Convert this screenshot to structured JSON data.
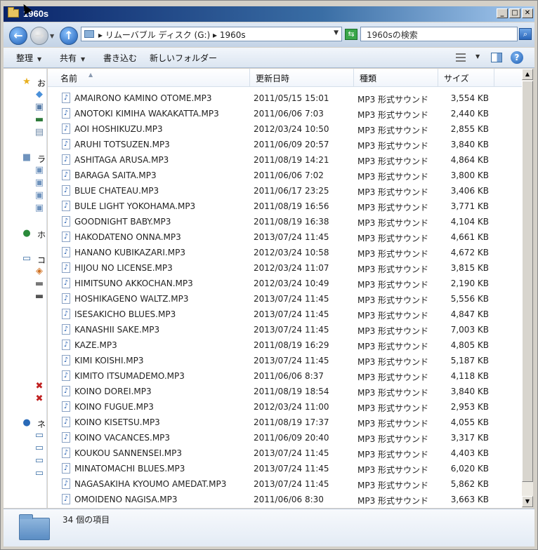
{
  "window": {
    "title": "1960s"
  },
  "address": {
    "path": "▸ リムーバブル ディスク (G:) ▸ 1960s",
    "search_placeholder": "1960sの検索"
  },
  "toolbar": {
    "organize": "整理",
    "share": "共有",
    "burn": "書き込む",
    "new_folder": "新しいフォルダー"
  },
  "navpane": {
    "favorites": "お",
    "libraries": "ラ",
    "homegroup": "ホ",
    "computer": "コ",
    "network": "ネ"
  },
  "columns": {
    "name": "名前",
    "date": "更新日時",
    "type": "種類",
    "size": "サイズ"
  },
  "files": [
    {
      "name": "AMAIRONO KAMINO OTOME.MP3",
      "date": "2011/05/15 15:01",
      "type": "MP3 形式サウンド",
      "size": "3,554 KB"
    },
    {
      "name": "ANOTOKI KIMIHA WAKAKATTA.MP3",
      "date": "2011/06/06 7:03",
      "type": "MP3 形式サウンド",
      "size": "2,440 KB"
    },
    {
      "name": "AOI HOSHIKUZU.MP3",
      "date": "2012/03/24 10:50",
      "type": "MP3 形式サウンド",
      "size": "2,855 KB"
    },
    {
      "name": "ARUHI TOTSUZEN.MP3",
      "date": "2011/06/09 20:57",
      "type": "MP3 形式サウンド",
      "size": "3,840 KB"
    },
    {
      "name": "ASHITAGA ARUSA.MP3",
      "date": "2011/08/19 14:21",
      "type": "MP3 形式サウンド",
      "size": "4,864 KB"
    },
    {
      "name": "BARAGA SAITA.MP3",
      "date": "2011/06/06 7:02",
      "type": "MP3 形式サウンド",
      "size": "3,800 KB"
    },
    {
      "name": "BLUE CHATEAU.MP3",
      "date": "2011/06/17 23:25",
      "type": "MP3 形式サウンド",
      "size": "3,406 KB"
    },
    {
      "name": "BULE LIGHT YOKOHAMA.MP3",
      "date": "2011/08/19 16:56",
      "type": "MP3 形式サウンド",
      "size": "3,771 KB"
    },
    {
      "name": "GOODNIGHT BABY.MP3",
      "date": "2011/08/19 16:38",
      "type": "MP3 形式サウンド",
      "size": "4,104 KB"
    },
    {
      "name": "HAKODATENO ONNA.MP3",
      "date": "2013/07/24 11:45",
      "type": "MP3 形式サウンド",
      "size": "4,661 KB"
    },
    {
      "name": "HANANO KUBIKAZARI.MP3",
      "date": "2012/03/24 10:58",
      "type": "MP3 形式サウンド",
      "size": "4,672 KB"
    },
    {
      "name": "HIJOU NO LICENSE.MP3",
      "date": "2012/03/24 11:07",
      "type": "MP3 形式サウンド",
      "size": "3,815 KB"
    },
    {
      "name": "HIMITSUNO AKKOCHAN.MP3",
      "date": "2012/03/24 10:49",
      "type": "MP3 形式サウンド",
      "size": "2,190 KB"
    },
    {
      "name": "HOSHIKAGENO WALTZ.MP3",
      "date": "2013/07/24 11:45",
      "type": "MP3 形式サウンド",
      "size": "5,556 KB"
    },
    {
      "name": "ISESAKICHO BLUES.MP3",
      "date": "2013/07/24 11:45",
      "type": "MP3 形式サウンド",
      "size": "4,847 KB"
    },
    {
      "name": "KANASHII SAKE.MP3",
      "date": "2013/07/24 11:45",
      "type": "MP3 形式サウンド",
      "size": "7,003 KB"
    },
    {
      "name": "KAZE.MP3",
      "date": "2011/08/19 16:29",
      "type": "MP3 形式サウンド",
      "size": "4,805 KB"
    },
    {
      "name": "KIMI KOISHI.MP3",
      "date": "2013/07/24 11:45",
      "type": "MP3 形式サウンド",
      "size": "5,187 KB"
    },
    {
      "name": "KIMITO ITSUMADEMO.MP3",
      "date": "2011/06/06 8:37",
      "type": "MP3 形式サウンド",
      "size": "4,118 KB"
    },
    {
      "name": "KOINO DOREI.MP3",
      "date": "2011/08/19 18:54",
      "type": "MP3 形式サウンド",
      "size": "3,840 KB"
    },
    {
      "name": "KOINO FUGUE.MP3",
      "date": "2012/03/24 11:00",
      "type": "MP3 形式サウンド",
      "size": "2,953 KB"
    },
    {
      "name": "KOINO KISETSU.MP3",
      "date": "2011/08/19 17:37",
      "type": "MP3 形式サウンド",
      "size": "4,055 KB"
    },
    {
      "name": "KOINO VACANCES.MP3",
      "date": "2011/06/09 20:40",
      "type": "MP3 形式サウンド",
      "size": "3,317 KB"
    },
    {
      "name": "KOUKOU SANNENSEI.MP3",
      "date": "2013/07/24 11:45",
      "type": "MP3 形式サウンド",
      "size": "4,403 KB"
    },
    {
      "name": "MINATOMACHI BLUES.MP3",
      "date": "2013/07/24 11:45",
      "type": "MP3 形式サウンド",
      "size": "6,020 KB"
    },
    {
      "name": "NAGASAKIHA KYOUMO AMEDAT.MP3",
      "date": "2013/07/24 11:45",
      "type": "MP3 形式サウンド",
      "size": "5,862 KB"
    },
    {
      "name": "OMOIDENO NAGISA.MP3",
      "date": "2011/06/06 8:30",
      "type": "MP3 形式サウンド",
      "size": "3,663 KB"
    }
  ],
  "details": {
    "item_count": "34 個の項目"
  },
  "icons": {
    "title": "folder-icon",
    "back": "back-arrow-icon",
    "forward": "forward-arrow-icon",
    "up": "up-arrow-icon",
    "refresh": "refresh-icon",
    "search": "search-icon",
    "help": "help-icon",
    "file": "audio-file-icon"
  }
}
